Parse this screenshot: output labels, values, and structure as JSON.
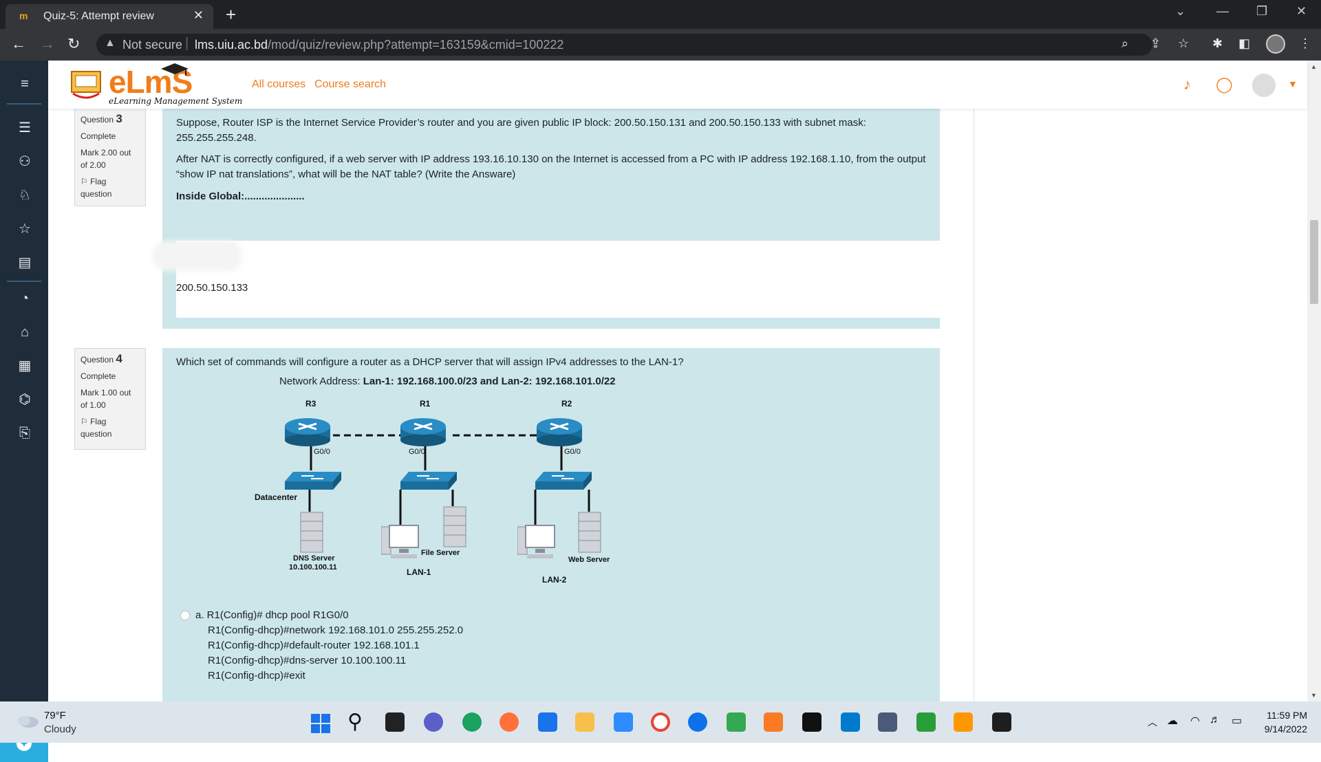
{
  "browser": {
    "tab_title": "Quiz-5: Attempt review",
    "tab_close": "✕",
    "new_tab": "+",
    "security_label": "Not secure",
    "url_host": "lms.uiu.ac.bd",
    "url_path": "/mod/quiz/review.php?attempt=163159&cmid=100222"
  },
  "site": {
    "logo_text": "eLmS",
    "logo_subtitle": "eLearning Management System",
    "nav_links": [
      "All courses",
      "Course search"
    ]
  },
  "questions": [
    {
      "number_prefix": "Question",
      "number": "3",
      "state": "Complete",
      "mark": "Mark 2.00 out of 2.00",
      "flag": "Flag question",
      "text1": "Suppose, Router ISP is the Internet Service Provider’s router and you are given public IP block: 200.50.150.131 and 200.50.150.133 with subnet mask: 255.255.255.248.",
      "text2": "After NAT is correctly configured, if a web server with IP address 193.16.10.130 on the Internet is accessed from a PC with IP address 192.168.1.10, from the output “show IP nat translations”, what will be the NAT table? (Write the Answare)",
      "inside_global": "Inside Global:.....................",
      "answer": "200.50.150.133"
    },
    {
      "number_prefix": "Question",
      "number": "4",
      "state": "Complete",
      "mark": "Mark 1.00 out of 1.00",
      "flag": "Flag question",
      "text": "Which set of commands will configure a router as a DHCP server that will assign IPv4  addresses to the LAN-1?",
      "network_label": "Network Address: ",
      "network_value": "Lan-1: 192.168.100.0/23 and Lan-2: 192.168.101.0/22",
      "diagram": {
        "routers": [
          "R3",
          "R1",
          "R2"
        ],
        "interfaces": [
          "G0/0",
          "G0/0",
          "G0/0"
        ],
        "datacenter": "Datacenter",
        "dns_server": "DNS Server",
        "dns_ip": "10.100.100.11",
        "file_server": "File Server",
        "web_server": "Web Server",
        "lan1": "LAN-1",
        "lan2": "LAN-2"
      },
      "option_a": [
        "a. R1(Config)# dhcp pool R1G0/0",
        "R1(Config-dhcp)#network 192.168.101.0 255.255.252.0",
        "R1(Config-dhcp)#default-router 192.168.101.1",
        "R1(Config-dhcp)#dns-server 10.100.100.11",
        "R1(Config-dhcp)#exit"
      ]
    }
  ],
  "taskbar": {
    "temperature": "79°F",
    "condition": "Cloudy",
    "time": "11:59 PM",
    "date": "9/14/2022"
  },
  "colors": {
    "brand_orange": "#f07d19",
    "question_bg": "#cce6ea",
    "nav_dark": "#1f2d3a",
    "router_blue": "#1a6e9c"
  }
}
